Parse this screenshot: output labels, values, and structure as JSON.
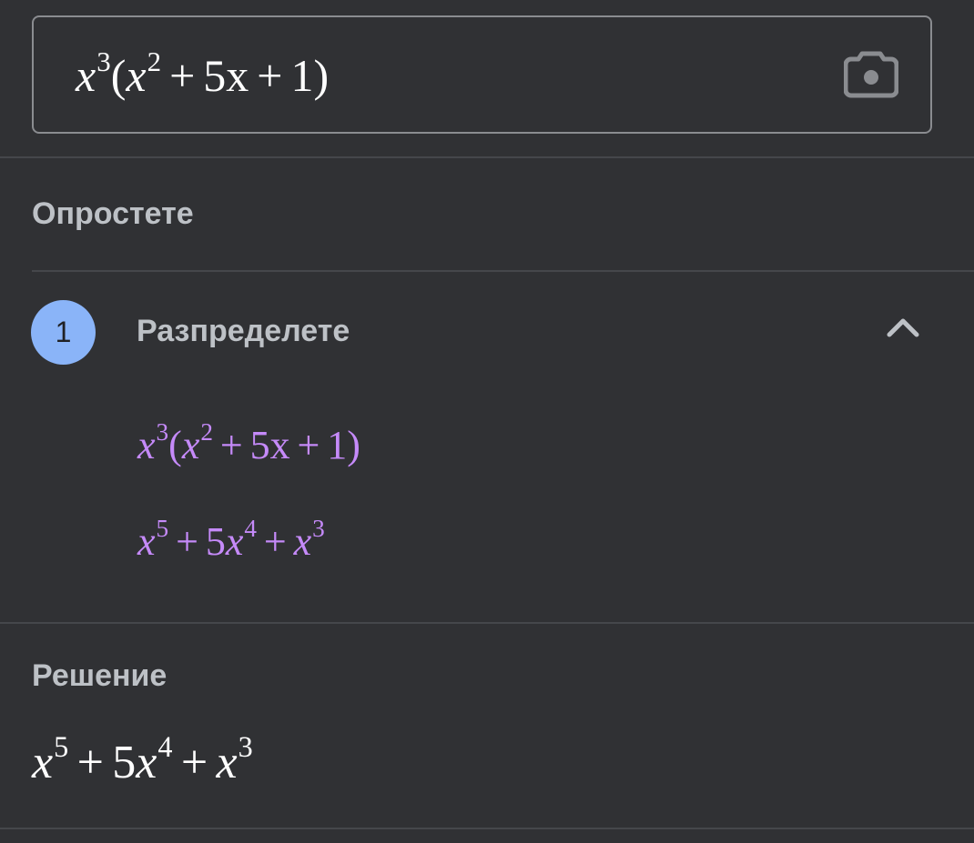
{
  "input": {
    "expression": {
      "base1": "x",
      "exp1": "3",
      "lparen": "(",
      "base2": "x",
      "exp2": "2",
      "plus1": "+",
      "term2": "5x",
      "plus2": "+",
      "term3": "1",
      "rparen": ")"
    },
    "camera_icon": "camera-icon"
  },
  "simplify": {
    "title": "Опростете"
  },
  "step1": {
    "number": "1",
    "label": "Разпределете",
    "chevron_icon": "chevron-up-icon",
    "line1": {
      "base1": "x",
      "exp1": "3",
      "lparen": "(",
      "base2": "x",
      "exp2": "2",
      "plus1": "+",
      "term2": "5x",
      "plus2": "+",
      "term3": "1",
      "rparen": ")"
    },
    "line2": {
      "base1": "x",
      "exp1": "5",
      "plus1": "+",
      "coef2": "5",
      "base2": "x",
      "exp2": "4",
      "plus2": "+",
      "base3": "x",
      "exp3": "3"
    }
  },
  "solution": {
    "title": "Решение",
    "result": {
      "base1": "x",
      "exp1": "5",
      "plus1": "+",
      "coef2": "5",
      "base2": "x",
      "exp2": "4",
      "plus2": "+",
      "base3": "x",
      "exp3": "3"
    }
  },
  "colors": {
    "background": "#303134",
    "step_badge": "#8ab4f8",
    "step_math": "#c58af9",
    "title_text": "#bdc1c6"
  }
}
